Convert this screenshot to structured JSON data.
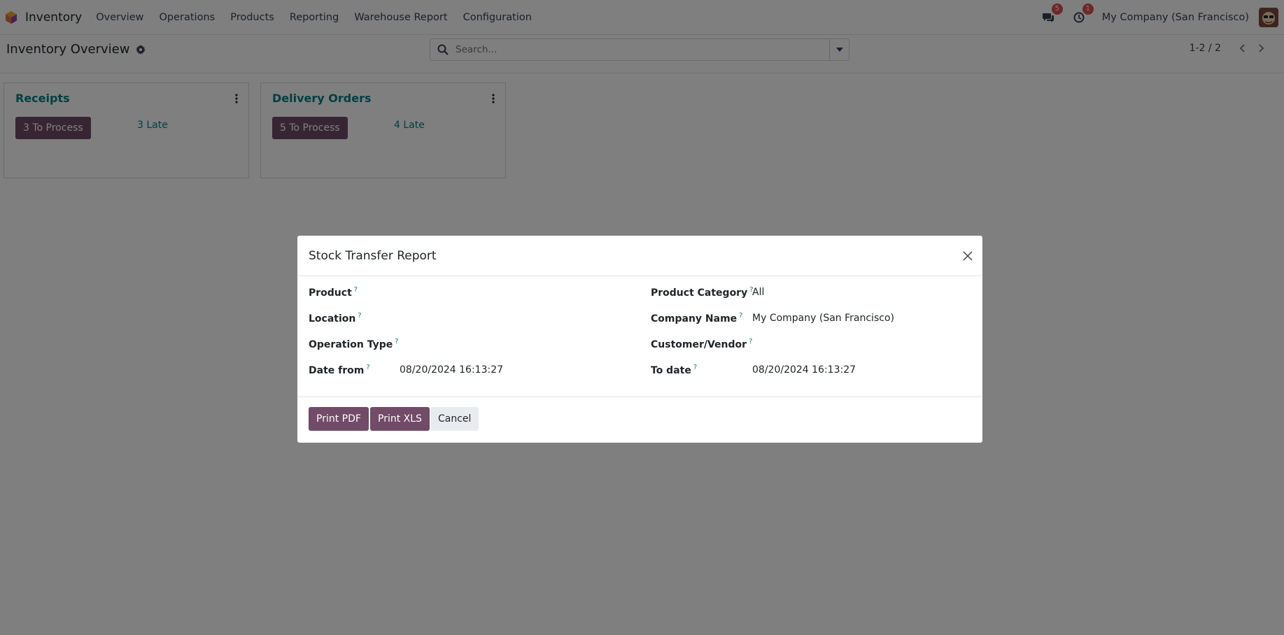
{
  "navbar": {
    "app_name": "Inventory",
    "menu": [
      "Overview",
      "Operations",
      "Products",
      "Reporting",
      "Warehouse Report",
      "Configuration"
    ],
    "messages_badge": "5",
    "activities_badge": "1",
    "company": "My Company (San Francisco)"
  },
  "control": {
    "title": "Inventory Overview",
    "search_placeholder": "Search...",
    "pager": "1-2 / 2"
  },
  "cards": [
    {
      "title": "Receipts",
      "process_label": "3 To Process",
      "late_label": "3 Late"
    },
    {
      "title": "Delivery Orders",
      "process_label": "5 To Process",
      "late_label": "4 Late"
    }
  ],
  "dialog": {
    "title": "Stock Transfer Report",
    "fields_left": [
      {
        "label": "Product",
        "value": ""
      },
      {
        "label": "Location",
        "value": ""
      },
      {
        "label": "Operation Type",
        "value": ""
      },
      {
        "label": "Date from",
        "value": "08/20/2024 16:13:27"
      }
    ],
    "fields_right": [
      {
        "label": "Product Category",
        "value": "All"
      },
      {
        "label": "Company Name",
        "value": "My Company (San Francisco)"
      },
      {
        "label": "Customer/Vendor",
        "value": ""
      },
      {
        "label": "To date",
        "value": "08/20/2024 16:13:27"
      }
    ],
    "help_mark": "?",
    "buttons": {
      "print_pdf": "Print PDF",
      "print_xls": "Print XLS",
      "cancel": "Cancel"
    }
  },
  "colors": {
    "brand": "#714b67",
    "teal": "#017e84",
    "badge": "#d9534f",
    "backdrop": "rgba(0,0,0,0.5)"
  }
}
